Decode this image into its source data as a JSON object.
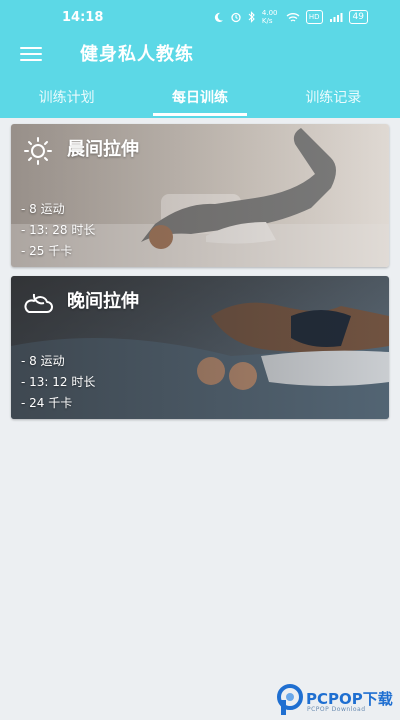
{
  "status_bar": {
    "time": "14:18",
    "signal_text": "4.00 K/s",
    "hd_badge": "HD",
    "battery": "49"
  },
  "app": {
    "title": "健身私人教练"
  },
  "tabs": [
    {
      "label": "训练计划",
      "active": false
    },
    {
      "label": "每日训练",
      "active": true
    },
    {
      "label": "训练记录",
      "active": false
    }
  ],
  "cards": [
    {
      "title": "晨间拉伸",
      "icon": "sun-icon",
      "stats": [
        "- 8 运动",
        "- 13: 28 时长",
        "- 25 千卡"
      ]
    },
    {
      "title": "晚间拉伸",
      "icon": "moon-cloud-icon",
      "stats": [
        "- 8 运动",
        "- 13: 12 时长",
        "- 24 千卡"
      ]
    }
  ],
  "watermark": {
    "text": "PCPOP下载",
    "sub": "PCPOP Download"
  },
  "colors": {
    "appbar": "#5cd8e6",
    "background": "#eceff2"
  }
}
